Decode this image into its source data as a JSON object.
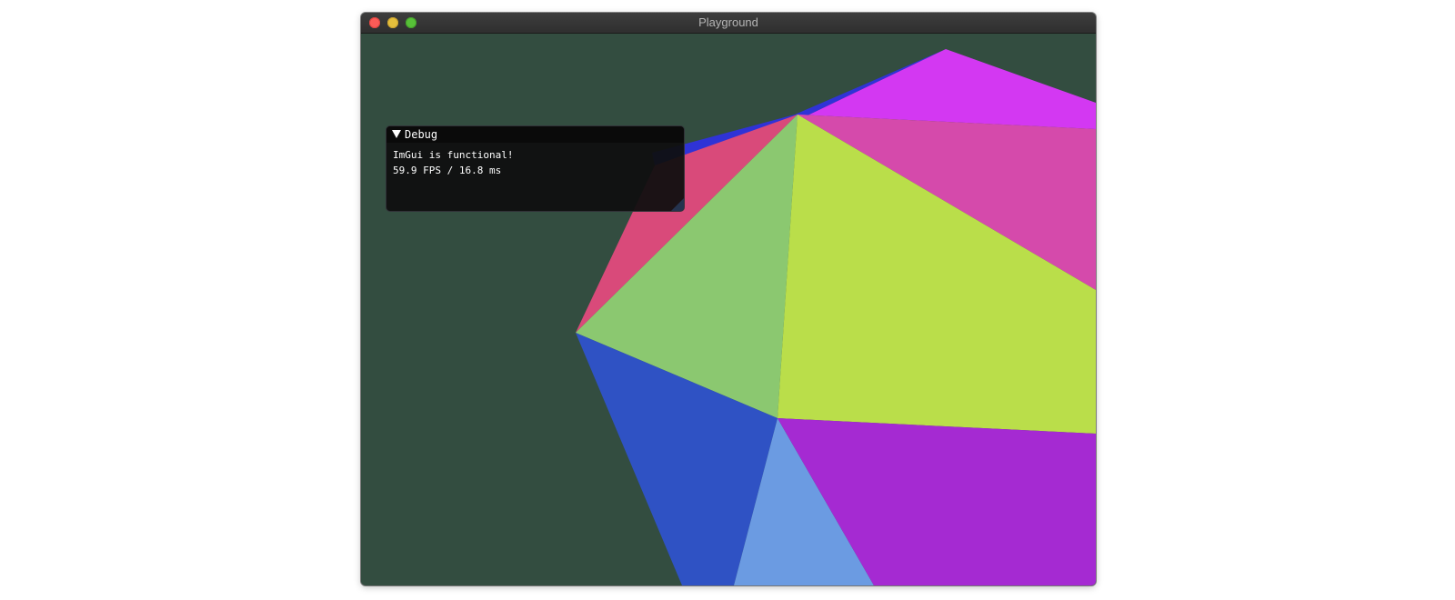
{
  "window": {
    "title": "Playground",
    "background_color": "#334d40"
  },
  "titlebar_buttons": [
    {
      "name": "close",
      "color": "#fc5b57"
    },
    {
      "name": "minimize",
      "color": "#e5bf3c"
    },
    {
      "name": "maximize",
      "color": "#57c038"
    }
  ],
  "debug_panel": {
    "title": "Debug",
    "collapse_icon": "triangle-down-icon",
    "lines": [
      "ImGui is functional!",
      "59.9 FPS / 16.8 ms"
    ]
  },
  "scene": {
    "face_colors": [
      "#2f33d6",
      "#d338f2",
      "#d54aab",
      "#d94a7a",
      "#8bc870",
      "#bade4a",
      "#2f52c4",
      "#6b9be2",
      "#a52ad2"
    ]
  }
}
